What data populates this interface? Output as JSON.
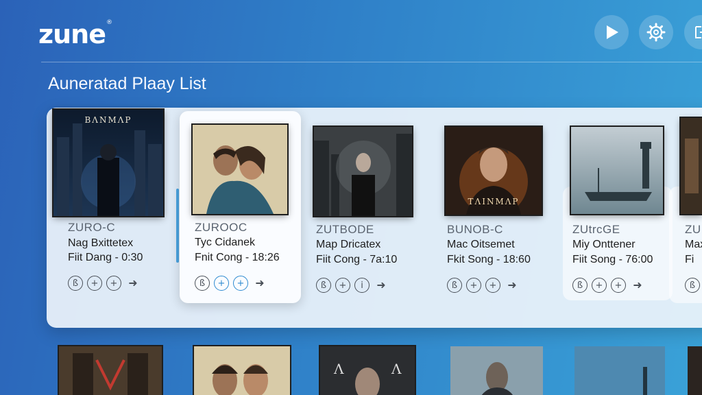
{
  "app": {
    "logo": "zune",
    "logo_mark": "®"
  },
  "header": {
    "buttons": [
      {
        "name": "play-button",
        "icon": "play-icon"
      },
      {
        "name": "settings-button",
        "icon": "gear-icon"
      },
      {
        "name": "exit-button",
        "icon": "exit-icon"
      }
    ]
  },
  "page": {
    "title": "Auneratad Plaay List"
  },
  "playlist": [
    {
      "cover_text": "ΒΛΝΜΛΡ",
      "artist": "ZURO-C",
      "title": "Nag Bxittetex",
      "meta": "Fiit Dang - 0:30"
    },
    {
      "cover_text": "",
      "artist": "ZUROOC",
      "title": "Tyc Cidanek",
      "meta": "Fnit Cong - 18:26"
    },
    {
      "cover_text": "",
      "artist": "ZUTBODE",
      "title": "Map Dricatex",
      "meta": "Fiit Cong - 7a:10"
    },
    {
      "cover_text": "ΤΛΙΝΜΛΡ",
      "artist": "BUNOB-C",
      "title": "Mac Oitsemet",
      "meta": "Fkit Song - 18:60"
    },
    {
      "cover_text": "",
      "artist": "ZUtrcGE",
      "title": "Miy Onttener",
      "meta": "Fiit Song - 76:00"
    },
    {
      "cover_text": "",
      "artist": "ZU",
      "title": "Max",
      "meta": "Fi"
    }
  ],
  "colors": {
    "accent": "#2d8ad0",
    "background_start": "#2b62b8",
    "background_end": "#3aa2d8"
  }
}
